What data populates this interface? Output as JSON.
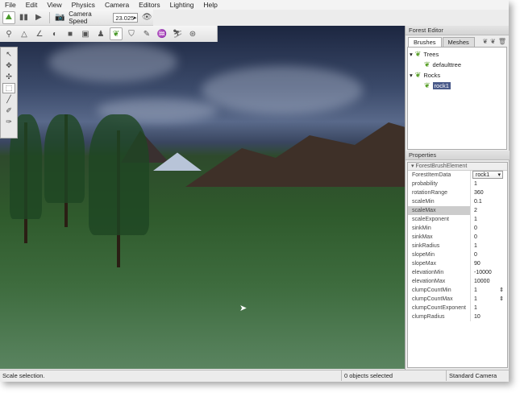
{
  "menu": [
    "File",
    "Edit",
    "View",
    "Physics",
    "Camera",
    "Editors",
    "Lighting",
    "Help"
  ],
  "toolbar": {
    "camera_speed_label": "Camera Speed",
    "camera_speed_value": "23.025"
  },
  "forest_editor": {
    "title": "Forest Editor",
    "tabs": [
      "Brushes",
      "Meshes"
    ],
    "active_tab": "Brushes",
    "tree": [
      {
        "label": "Trees",
        "children": [
          "defaulttree"
        ]
      },
      {
        "label": "Rocks",
        "children": [
          "rock1"
        ]
      }
    ],
    "selected": "rock1"
  },
  "properties": {
    "title": "Properties",
    "group": "ForestBrushElement",
    "rows": [
      {
        "k": "ForestItemData",
        "v": "rock1"
      },
      {
        "k": "probability",
        "v": "1"
      },
      {
        "k": "rotationRange",
        "v": "360"
      },
      {
        "k": "scaleMin",
        "v": "0.1"
      },
      {
        "k": "scaleMax",
        "v": "2"
      },
      {
        "k": "scaleExponent",
        "v": "1"
      },
      {
        "k": "sinkMin",
        "v": "0"
      },
      {
        "k": "sinkMax",
        "v": "0"
      },
      {
        "k": "sinkRadius",
        "v": "1"
      },
      {
        "k": "slopeMin",
        "v": "0"
      },
      {
        "k": "slopeMax",
        "v": "90"
      },
      {
        "k": "elevationMin",
        "v": "-10000"
      },
      {
        "k": "elevationMax",
        "v": "10000"
      },
      {
        "k": "clumpCountMin",
        "v": "1"
      },
      {
        "k": "clumpCountMax",
        "v": "1"
      },
      {
        "k": "clumpCountExponent",
        "v": "1"
      },
      {
        "k": "clumpRadius",
        "v": "10"
      }
    ],
    "highlighted": "scaleMax"
  },
  "status": {
    "left": "Scale selection.",
    "middle": "0 objects selected",
    "right": "Standard Camera"
  }
}
